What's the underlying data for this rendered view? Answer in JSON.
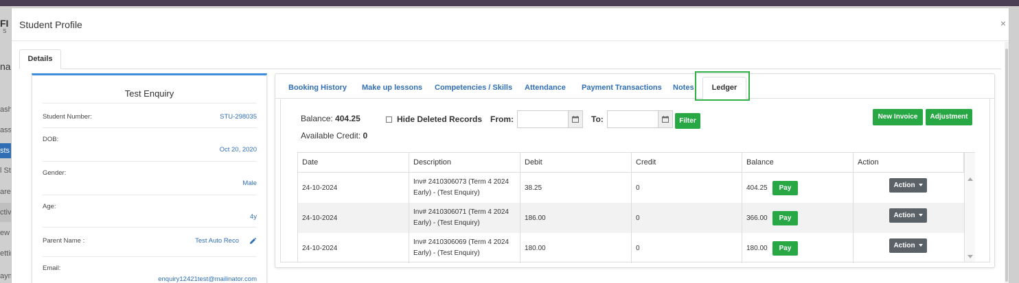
{
  "background": {
    "fragments": [
      "FI",
      "S",
      "na",
      "ash",
      "ass",
      "sts",
      "l St",
      "are",
      "ctive",
      "ew",
      "ettin",
      "aym"
    ]
  },
  "modal": {
    "title": "Student Profile",
    "close": "×",
    "details_tab": "Details"
  },
  "profile": {
    "name": "Test Enquiry",
    "fields": [
      {
        "label": "Student Number:",
        "value": "STU-298035"
      },
      {
        "label": "DOB:",
        "value": "Oct 20, 2020"
      },
      {
        "label": "Gender:",
        "value": "Male"
      },
      {
        "label": "Age:",
        "value": "4y"
      },
      {
        "label": "Parent Name :",
        "value": "Test Auto Reco"
      },
      {
        "label": "Email:",
        "value": "enquiry12421test@mailinator.com"
      }
    ]
  },
  "tabs": [
    "Booking History",
    "Make up lessons",
    "Competencies / Skills",
    "Attendance",
    "Payment Transactions",
    "Notes",
    "Ledger"
  ],
  "active_tab": "Ledger",
  "ledger": {
    "balance_label": "Balance:",
    "balance_value": "404.25",
    "credit_label": "Available Credit:",
    "credit_value": "0",
    "hide_deleted_label": "Hide Deleted Records",
    "hide_deleted_checked": false,
    "from_label": "From:",
    "to_label": "To:",
    "from_value": "",
    "to_value": "",
    "filter_label": "Filter",
    "new_invoice_label": "New Invoice",
    "adjustment_label": "Adjustment",
    "columns": [
      "Date",
      "Description",
      "Debit",
      "Credit",
      "Balance",
      "Action"
    ],
    "rows": [
      {
        "date": "24-10-2024",
        "desc1": "Inv# 2410306073 (Term 4 2024",
        "desc2": "Early) - (Test Enquiry)",
        "debit": "38.25",
        "credit": "0",
        "balance": "404.25",
        "pay": "Pay",
        "action": "Action"
      },
      {
        "date": "24-10-2024",
        "desc1": "Inv# 2410306071 (Term 4 2024",
        "desc2": "Early) - (Test Enquiry)",
        "debit": "186.00",
        "credit": "0",
        "balance": "366.00",
        "pay": "Pay",
        "action": "Action"
      },
      {
        "date": "24-10-2024",
        "desc1": "Inv# 2410306069 (Term 4 2024",
        "desc2": "Early) - (Test Enquiry)",
        "debit": "180.00",
        "credit": "0",
        "balance": "180.00",
        "pay": "Pay",
        "action": "Action"
      }
    ]
  },
  "colors": {
    "accent_blue": "#2f6eb5",
    "green": "#28a745",
    "highlight_box": "#2eae45",
    "action_grey": "#5a6268"
  }
}
